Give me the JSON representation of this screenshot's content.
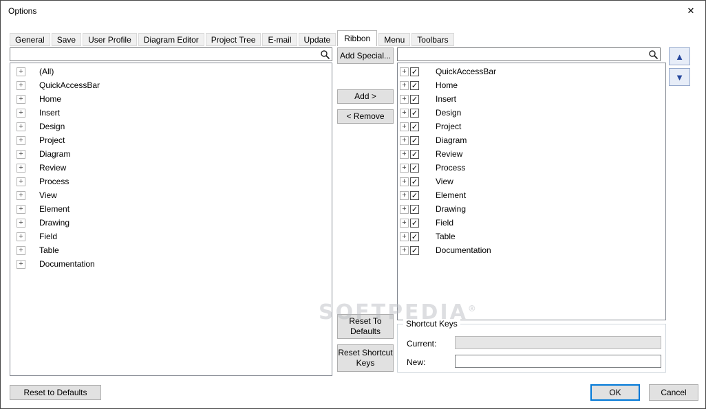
{
  "window": {
    "title": "Options"
  },
  "icons": {
    "close": "✕",
    "up": "▲",
    "down": "▼",
    "expand": "+",
    "check": "✓"
  },
  "colors": {
    "accent": "#0078d7",
    "arrow_blue": "#24469c",
    "tree_border": "#828790"
  },
  "tabs": {
    "items": [
      "General",
      "Save",
      "User Profile",
      "Diagram Editor",
      "Project Tree",
      "E-mail",
      "Update",
      "Ribbon",
      "Menu",
      "Toolbars"
    ],
    "active": "Ribbon"
  },
  "available": {
    "search_value": "",
    "items": [
      "(All)",
      "QuickAccessBar",
      "Home",
      "Insert",
      "Design",
      "Project",
      "Diagram",
      "Review",
      "Process",
      "View",
      "Element",
      "Drawing",
      "Field",
      "Table",
      "Documentation"
    ]
  },
  "selected": {
    "search_value": "",
    "items": [
      {
        "label": "QuickAccessBar",
        "checked": true
      },
      {
        "label": "Home",
        "checked": true
      },
      {
        "label": "Insert",
        "checked": true
      },
      {
        "label": "Design",
        "checked": true
      },
      {
        "label": "Project",
        "checked": true
      },
      {
        "label": "Diagram",
        "checked": true
      },
      {
        "label": "Review",
        "checked": true
      },
      {
        "label": "Process",
        "checked": true
      },
      {
        "label": "View",
        "checked": true
      },
      {
        "label": "Element",
        "checked": true
      },
      {
        "label": "Drawing",
        "checked": true
      },
      {
        "label": "Field",
        "checked": true
      },
      {
        "label": "Table",
        "checked": true
      },
      {
        "label": "Documentation",
        "checked": true
      }
    ]
  },
  "actions": {
    "add_special": "Add Special...",
    "add": "Add >",
    "remove": "< Remove",
    "reset_to_defaults": "Reset To Defaults",
    "reset_shortcut_keys": "Reset Shortcut Keys"
  },
  "shortcut_keys": {
    "title": "Shortcut Keys",
    "current_label": "Current:",
    "current_value": "",
    "new_label": "New:",
    "new_value": ""
  },
  "footer": {
    "reset_to_defaults": "Reset to Defaults",
    "ok": "OK",
    "cancel": "Cancel"
  },
  "watermark": {
    "text": "SOFTPEDIA",
    "mark": "®"
  }
}
